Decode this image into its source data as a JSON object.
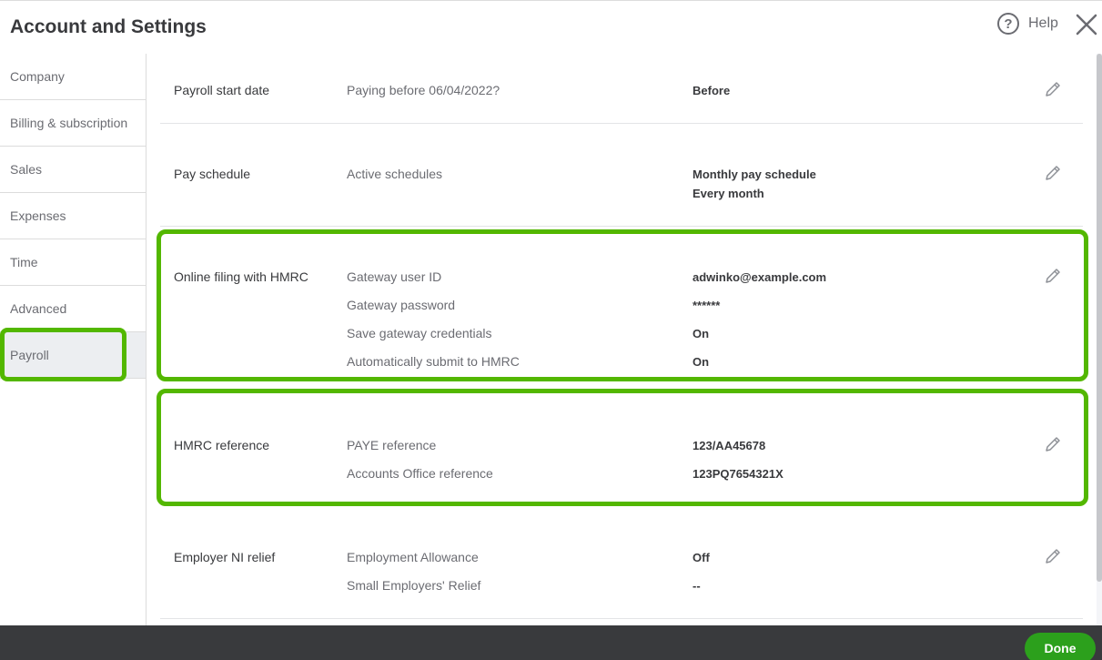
{
  "header": {
    "title": "Account and Settings",
    "help_label": "Help",
    "help_glyph": "?"
  },
  "sidebar": {
    "items": [
      {
        "label": "Company"
      },
      {
        "label": "Billing & subscription"
      },
      {
        "label": "Sales"
      },
      {
        "label": "Expenses"
      },
      {
        "label": "Time"
      },
      {
        "label": "Advanced"
      },
      {
        "label": "Payroll",
        "selected": true
      }
    ]
  },
  "sections": {
    "payroll_start": {
      "title": "Payroll start date",
      "fields": [
        {
          "label": "Paying before 06/04/2022?",
          "value": "Before"
        }
      ]
    },
    "pay_schedule": {
      "title": "Pay schedule",
      "fields": [
        {
          "label": "Active schedules",
          "value": "Monthly pay schedule",
          "value2": "Every month"
        }
      ]
    },
    "online_filing": {
      "title": "Online filing with HMRC",
      "fields": [
        {
          "label": "Gateway user ID",
          "value": "adwinko@example.com"
        },
        {
          "label": "Gateway password",
          "value": "******"
        },
        {
          "label": "Save gateway credentials",
          "value": "On"
        },
        {
          "label": "Automatically submit to HMRC",
          "value": "On"
        }
      ]
    },
    "hmrc_reference": {
      "title": "HMRC reference",
      "fields": [
        {
          "label": "PAYE reference",
          "value": "123/AA45678"
        },
        {
          "label": "Accounts Office reference",
          "value": "123PQ7654321X"
        }
      ]
    },
    "employer_ni": {
      "title": "Employer NI relief",
      "fields": [
        {
          "label": "Employment Allowance",
          "value": "Off"
        },
        {
          "label": "Small Employers' Relief",
          "value": "--"
        }
      ]
    }
  },
  "footer": {
    "done_label": "Done"
  },
  "colors": {
    "highlight": "#53b700",
    "primary_button": "#2ca01c",
    "footer_bg": "#393a3d",
    "selected_nav_bg": "#eceef1"
  },
  "icons": {
    "help": "help-circle-icon",
    "close": "close-icon",
    "edit": "pencil-icon"
  }
}
